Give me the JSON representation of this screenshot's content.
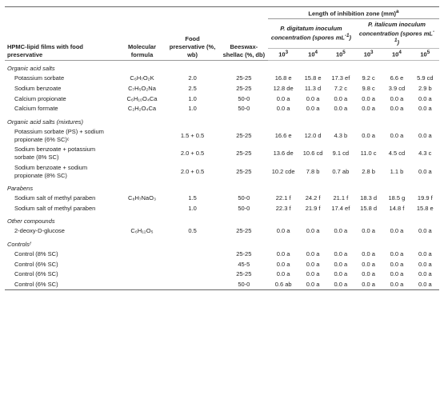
{
  "table": {
    "main_header": {
      "col1": "HPMC-lipid films with food preservative",
      "col2": "Molecular formula",
      "col3": "Food preservative (%, wb)",
      "col4": "Beeswax-shellac (%, db)",
      "zone_header": "Length of inhibition zone (mm)",
      "zone_note": "a",
      "p_digitatum": "P. digitatum inoculum concentration (spores mL⁻¹)",
      "p_italicum": "P. italicum inoculum concentration (spores mL⁻¹)",
      "conc1": "10",
      "conc1_sup": "3",
      "conc2": "10",
      "conc2_sup": "4",
      "conc3": "10",
      "conc3_sup": "5",
      "conc4": "10",
      "conc4_sup": "3",
      "conc5": "10",
      "conc5_sup": "4",
      "conc6": "10",
      "conc6_sup": "5"
    },
    "sections": [
      {
        "section_title": "Organic acid salts",
        "rows": [
          {
            "name": "Potassium sorbate",
            "formula": "C₆H₇O₂K",
            "food_pres": "2.0",
            "beeswax": "25-25",
            "d1": "16.8 e",
            "d2": "15.8 e",
            "d3": "17.3 ef",
            "i1": "9.2 c",
            "i2": "6.6 e",
            "i3": "5.9 cd"
          },
          {
            "name": "Sodium benzoate",
            "formula": "C₇H₅O₂Na",
            "food_pres": "2.5",
            "beeswax": "25-25",
            "d1": "12.8 de",
            "d2": "11.3 d",
            "d3": "7.2 c",
            "i1": "9.8 c",
            "i2": "3.9 cd",
            "i3": "2.9 b"
          },
          {
            "name": "Calcium propionate",
            "formula": "C₆H₁₀O₄Ca",
            "food_pres": "1.0",
            "beeswax": "50-0",
            "d1": "0.0 a",
            "d2": "0.0 a",
            "d3": "0.0 a",
            "i1": "0.0 a",
            "i2": "0.0 a",
            "i3": "0.0 a"
          },
          {
            "name": "Calcium formate",
            "formula": "C₂H₂O₄Ca",
            "food_pres": "1.0",
            "beeswax": "50-0",
            "d1": "0.0 a",
            "d2": "0.0 a",
            "d3": "0.0 a",
            "i1": "0.0 a",
            "i2": "0.0 a",
            "i3": "0.0 a"
          }
        ]
      },
      {
        "section_title": "Organic acid salts (mixtures)",
        "rows": [
          {
            "name": "Potassium sorbate (PS) + sodium propionate (6% SC)ᶜ",
            "formula": "",
            "food_pres": "1.5 + 0.5",
            "beeswax": "25-25",
            "d1": "16.6 e",
            "d2": "12.0 d",
            "d3": "4.3 b",
            "i1": "0.0 a",
            "i2": "0.0 a",
            "i3": "0.0 a"
          },
          {
            "name": "Sodium benzoate + potassium sorbate (8% SC)",
            "formula": "",
            "food_pres": "2.0 + 0.5",
            "beeswax": "25-25",
            "d1": "13.6 de",
            "d2": "10.6 cd",
            "d3": "9.1 cd",
            "i1": "11.0 c",
            "i2": "4.5 cd",
            "i3": "4.3 c"
          },
          {
            "name": "Sodium benzoate + sodium propionate (8% SC)",
            "formula": "",
            "food_pres": "2.0 + 0.5",
            "beeswax": "25-25",
            "d1": "10.2 cde",
            "d2": "7.8 b",
            "d3": "0.7 ab",
            "i1": "2.8 b",
            "i2": "1.1 b",
            "i3": "0.0 a"
          }
        ]
      },
      {
        "section_title": "Parabens",
        "rows": [
          {
            "name": "Sodium salt of methyl paraben",
            "formula": "C₈H₇NaO₃",
            "food_pres": "1.5",
            "beeswax": "50-0",
            "d1": "22.1 f",
            "d2": "24.2 f",
            "d3": "21.1 f",
            "i1": "18.3 d",
            "i2": "18.5 g",
            "i3": "19.9 f"
          },
          {
            "name": "Sodium salt of methyl paraben",
            "formula": "",
            "food_pres": "1.0",
            "beeswax": "50-0",
            "d1": "22.3 f",
            "d2": "21.9 f",
            "d3": "17.4 ef",
            "i1": "15.8 d",
            "i2": "14.8 f",
            "i3": "15.8 e"
          }
        ]
      },
      {
        "section_title": "Other compounds",
        "rows": [
          {
            "name": "2-deoxy-D-glucose",
            "formula": "C₆H₁₂O₅",
            "food_pres": "0.5",
            "beeswax": "25-25",
            "d1": "0.0 a",
            "d2": "0.0 a",
            "d3": "0.0 a",
            "i1": "0.0 a",
            "i2": "0.0 a",
            "i3": "0.0 a"
          }
        ]
      },
      {
        "section_title": "Controlsᶠ",
        "rows": [
          {
            "name": "Control (8% SC)",
            "formula": "",
            "food_pres": "",
            "beeswax": "25-25",
            "d1": "0.0 a",
            "d2": "0.0 a",
            "d3": "0.0 a",
            "i1": "0.0 a",
            "i2": "0.0 a",
            "i3": "0.0 a"
          },
          {
            "name": "Control (6% SC)",
            "formula": "",
            "food_pres": "",
            "beeswax": "45-5",
            "d1": "0.0 a",
            "d2": "0.0 a",
            "d3": "0.0 a",
            "i1": "0.0 a",
            "i2": "0.0 a",
            "i3": "0.0 a"
          },
          {
            "name": "Control (6% SC)",
            "formula": "",
            "food_pres": "",
            "beeswax": "25-25",
            "d1": "0.0 a",
            "d2": "0.0 a",
            "d3": "0.0 a",
            "i1": "0.0 a",
            "i2": "0.0 a",
            "i3": "0.0 a"
          },
          {
            "name": "Control (6% SC)",
            "formula": "",
            "food_pres": "",
            "beeswax": "50-0",
            "d1": "0.6 ab",
            "d2": "0.0 a",
            "d3": "0.0 a",
            "i1": "0.0 a",
            "i2": "0.0 a",
            "i3": "0.0 a"
          }
        ]
      }
    ]
  }
}
